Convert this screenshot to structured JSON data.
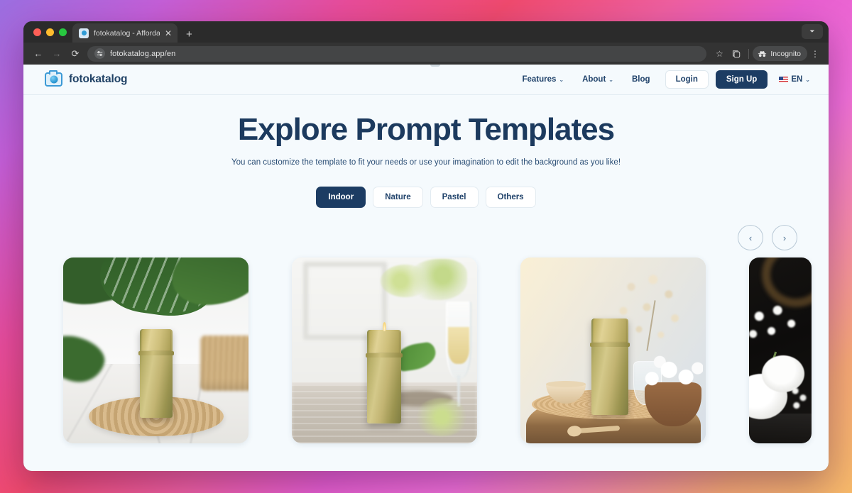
{
  "browser": {
    "tab": {
      "title": "fotokatalog - Affordable and S",
      "favicon_icon": "camera-favicon",
      "close_icon": "close-icon"
    },
    "new_tab_icon": "plus-icon",
    "window_chevron_icon": "chevron-down-icon",
    "traffic_lights": [
      "close-red",
      "minimize-yellow",
      "maximize-green"
    ],
    "toolbar": {
      "back_icon": "arrow-left-icon",
      "forward_icon": "arrow-right-icon",
      "reload_icon": "reload-icon",
      "site_settings_icon": "tune-icon",
      "url": "fotokatalog.app/en",
      "bookmark_icon": "star-icon",
      "split_view_icon": "split-tab-icon",
      "incognito_label": "Incognito",
      "incognito_icon": "incognito-hat-icon",
      "menu_icon": "kebab-menu-icon"
    }
  },
  "site": {
    "brand": {
      "logo_icon": "camera-icon",
      "name": "fotokatalog"
    },
    "nav": [
      {
        "label": "Features",
        "has_caret": true,
        "caret": "⌄"
      },
      {
        "label": "About",
        "has_caret": true,
        "caret": "⌄"
      },
      {
        "label": "Blog",
        "has_caret": false,
        "caret": ""
      }
    ],
    "auth": {
      "login_label": "Login",
      "signup_label": "Sign Up"
    },
    "language": {
      "code": "EN",
      "flag_icon": "us-flag-icon",
      "caret": "⌄"
    }
  },
  "hero": {
    "title": "Explore Prompt Templates",
    "subtitle": "You can customize the template to fit your needs or use your imagination to edit the background as you like!"
  },
  "filters": {
    "items": [
      {
        "label": "Indoor",
        "active": true
      },
      {
        "label": "Nature",
        "active": false
      },
      {
        "label": "Pastel",
        "active": false
      },
      {
        "label": "Others",
        "active": false
      }
    ]
  },
  "carousel": {
    "prev_icon": "chevron-left-icon",
    "prev_glyph": "‹",
    "next_icon": "chevron-right-icon",
    "next_glyph": "›",
    "cards": [
      {
        "name": "template-card-tropical-marble",
        "alt": "Gold tin on woven rattan mat with monstera leaves on marble counter"
      },
      {
        "name": "template-card-dining-table",
        "alt": "Gold tin on wooden table with champagne glass and green sprigs"
      },
      {
        "name": "template-card-wood-stump",
        "alt": "Gold tin on wood stump with bowl, spoon, dried gypsophila and white daisies"
      },
      {
        "name": "template-card-dark-florals",
        "alt": "White flowers on dark moody background"
      }
    ]
  },
  "theme": {
    "page_gradient_start": "#9b6ee0",
    "page_gradient_mid": "#e84c9a",
    "page_gradient_end": "#f7b96a",
    "brand_navy": "#1c3c63",
    "text_navy": "#21436b",
    "viewport_bg": "#f5fafd",
    "logo_blue": "#2e9bd6"
  }
}
